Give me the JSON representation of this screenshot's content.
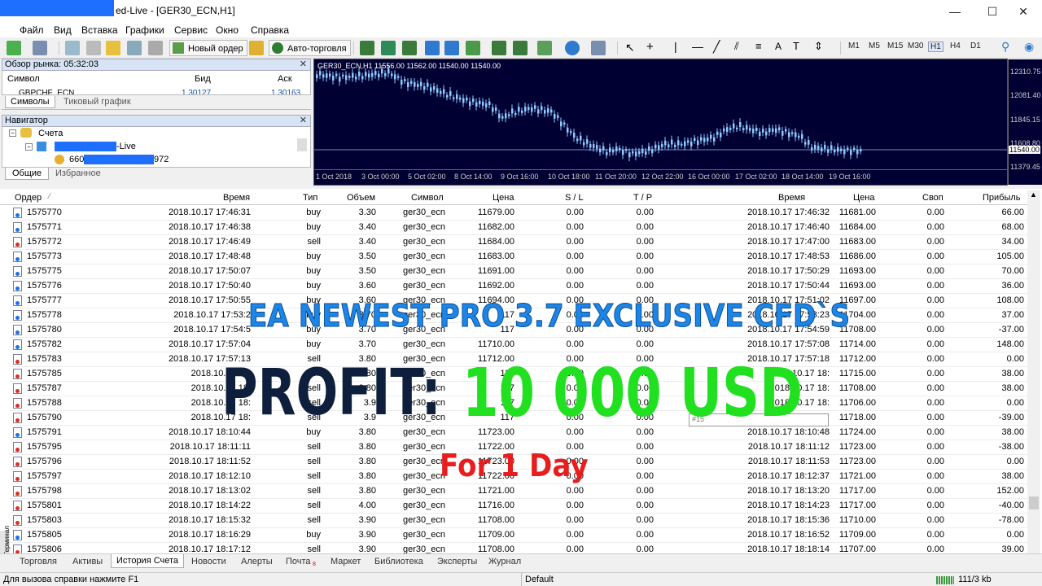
{
  "window": {
    "title_suffix": "ed-Live - [GER30_ECN,H1]",
    "minimize": "—",
    "maximize": "☐",
    "close": "✕"
  },
  "menu": [
    "Файл",
    "Вид",
    "Вставка",
    "Графики",
    "Сервис",
    "Окно",
    "Справка"
  ],
  "toolbar": {
    "new_order": "Новый ордер",
    "auto_trading": "Авто-торговля",
    "timeframes": [
      "M1",
      "M5",
      "M15",
      "M30",
      "H1",
      "H4",
      "D1"
    ],
    "text_tool": "A"
  },
  "market_watch": {
    "title": "Обзор рынка: 05:32:03",
    "col_symbol": "Символ",
    "col_bid": "Бид",
    "col_ask": "Аск",
    "row_symbol": "GBPCHF_ECN",
    "row_bid": "1.30127",
    "row_ask": "1.30163",
    "tab_symbols": "Символы",
    "tab_tick": "Тиковый график"
  },
  "navigator": {
    "title": "Навигатор",
    "accounts": "Счета",
    "account_suffix": "-Live",
    "account_prefix": "660",
    "account_end": "972",
    "tab_general": "Общие",
    "tab_fav": "Избранное"
  },
  "chart": {
    "header": "GER30_ECN,H1  11556.00 11562.00 11540.00 11540.00",
    "price_labels": [
      "12310.75",
      "12081.40",
      "11845.15",
      "11608.80",
      "11540.00",
      "11379.45"
    ],
    "time_labels": [
      "1 Oct 2018",
      "3 Oct 00:00",
      "5 Oct 02:00",
      "8 Oct 14:00",
      "9 Oct 16:00",
      "10 Oct 18:00",
      "11 Oct 20:00",
      "12 Oct 22:00",
      "16 Oct 00:00",
      "17 Oct 02:00",
      "18 Oct 14:00",
      "19 Oct 16:00"
    ]
  },
  "terminal": {
    "headers": {
      "order": "Ордер",
      "time": "Время",
      "type": "Тип",
      "volume": "Объем",
      "symbol": "Символ",
      "price": "Цена",
      "sl": "S / L",
      "tp": "T / P",
      "time2": "Время",
      "price2": "Цена",
      "swap": "Своп",
      "profit": "Прибыль"
    },
    "side_label": "Терминал",
    "rows": [
      {
        "order": "1575770",
        "time": "2018.10.17 17:46:31",
        "type": "buy",
        "volume": "3.30",
        "symbol": "ger30_ecn",
        "price": "11679.00",
        "sl": "0.00",
        "tp": "0.00",
        "time2": "2018.10.17 17:46:32",
        "price2": "11681.00",
        "swap": "0.00",
        "profit": "66.00"
      },
      {
        "order": "1575771",
        "time": "2018.10.17 17:46:38",
        "type": "buy",
        "volume": "3.40",
        "symbol": "ger30_ecn",
        "price": "11682.00",
        "sl": "0.00",
        "tp": "0.00",
        "time2": "2018.10.17 17:46:40",
        "price2": "11684.00",
        "swap": "0.00",
        "profit": "68.00"
      },
      {
        "order": "1575772",
        "time": "2018.10.17 17:46:49",
        "type": "sell",
        "volume": "3.40",
        "symbol": "ger30_ecn",
        "price": "11684.00",
        "sl": "0.00",
        "tp": "0.00",
        "time2": "2018.10.17 17:47:00",
        "price2": "11683.00",
        "swap": "0.00",
        "profit": "34.00"
      },
      {
        "order": "1575773",
        "time": "2018.10.17 17:48:48",
        "type": "buy",
        "volume": "3.50",
        "symbol": "ger30_ecn",
        "price": "11683.00",
        "sl": "0.00",
        "tp": "0.00",
        "time2": "2018.10.17 17:48:53",
        "price2": "11686.00",
        "swap": "0.00",
        "profit": "105.00"
      },
      {
        "order": "1575775",
        "time": "2018.10.17 17:50:07",
        "type": "buy",
        "volume": "3.50",
        "symbol": "ger30_ecn",
        "price": "11691.00",
        "sl": "0.00",
        "tp": "0.00",
        "time2": "2018.10.17 17:50:29",
        "price2": "11693.00",
        "swap": "0.00",
        "profit": "70.00"
      },
      {
        "order": "1575776",
        "time": "2018.10.17 17:50:40",
        "type": "buy",
        "volume": "3.60",
        "symbol": "ger30_ecn",
        "price": "11692.00",
        "sl": "0.00",
        "tp": "0.00",
        "time2": "2018.10.17 17:50:44",
        "price2": "11693.00",
        "swap": "0.00",
        "profit": "36.00"
      },
      {
        "order": "1575777",
        "time": "2018.10.17 17:50:55",
        "type": "buy",
        "volume": "3.60",
        "symbol": "ger30_ecn",
        "price": "11694.00",
        "sl": "0.00",
        "tp": "0.00",
        "time2": "2018.10.17 17:51:02",
        "price2": "11697.00",
        "swap": "0.00",
        "profit": "108.00"
      },
      {
        "order": "1575778",
        "time": "2018.10.17 17:53:2",
        "type": "buy",
        "volume": "3.70",
        "symbol": "ger30_ecn",
        "price": "117",
        "sl": "0.00",
        "tp": "0.00",
        "time2": "2018.10.17 17:53:23",
        "price2": "11704.00",
        "swap": "0.00",
        "profit": "37.00"
      },
      {
        "order": "1575780",
        "time": "2018.10.17 17:54:5",
        "type": "buy",
        "volume": "3.70",
        "symbol": "ger30_ecn",
        "price": "117",
        "sl": "0.00",
        "tp": "0.00",
        "time2": "2018.10.17 17:54:59",
        "price2": "11708.00",
        "swap": "0.00",
        "profit": "-37.00"
      },
      {
        "order": "1575782",
        "time": "2018.10.17 17:57:04",
        "type": "buy",
        "volume": "3.70",
        "symbol": "ger30_ecn",
        "price": "11710.00",
        "sl": "0.00",
        "tp": "0.00",
        "time2": "2018.10.17 17:57:08",
        "price2": "11714.00",
        "swap": "0.00",
        "profit": "148.00"
      },
      {
        "order": "1575783",
        "time": "2018.10.17 17:57:13",
        "type": "sell",
        "volume": "3.80",
        "symbol": "ger30_ecn",
        "price": "11712.00",
        "sl": "0.00",
        "tp": "0.00",
        "time2": "2018.10.17 17:57:18",
        "price2": "11712.00",
        "swap": "0.00",
        "profit": "0.00"
      },
      {
        "order": "1575785",
        "time": "2018.10.17 18:",
        "type": "sell",
        "volume": "3.80",
        "symbol": "ger30_ecn",
        "price": "117",
        "sl": "0.00",
        "tp": "0.00",
        "time2": "2018.10.17 18:",
        "price2": "11715.00",
        "swap": "0.00",
        "profit": "38.00"
      },
      {
        "order": "1575787",
        "time": "2018.10.17 18:",
        "type": "sell",
        "volume": "3.80",
        "symbol": "ger30_ecn",
        "price": "117",
        "sl": "0.00",
        "tp": "0.00",
        "time2": "2018.10.17 18:",
        "price2": "11708.00",
        "swap": "0.00",
        "profit": "38.00"
      },
      {
        "order": "1575788",
        "time": "2018.10.17 18:",
        "type": "sell",
        "volume": "3.9",
        "symbol": "ger30_ecn",
        "price": "117",
        "sl": "0.00",
        "tp": "0.00",
        "time2": "2018.10.17 18:",
        "price2": "11706.00",
        "swap": "0.00",
        "profit": "0.00"
      },
      {
        "order": "1575790",
        "time": "2018.10.17 18:",
        "type": "sell",
        "volume": "3.9",
        "symbol": "ger30_ecn",
        "price": "117",
        "sl": "0.00",
        "tp": "0.00",
        "time2": "2018.10.17 18:",
        "price2": "11718.00",
        "swap": "0.00",
        "profit": "-39.00"
      },
      {
        "order": "1575791",
        "time": "2018.10.17 18:10:44",
        "type": "buy",
        "volume": "3.80",
        "symbol": "ger30_ecn",
        "price": "11723.00",
        "sl": "0.00",
        "tp": "0.00",
        "time2": "2018.10.17 18:10:48",
        "price2": "11724.00",
        "swap": "0.00",
        "profit": "38.00"
      },
      {
        "order": "1575795",
        "time": "2018.10.17 18:11:11",
        "type": "sell",
        "volume": "3.80",
        "symbol": "ger30_ecn",
        "price": "11722.00",
        "sl": "0.00",
        "tp": "0.00",
        "time2": "2018.10.17 18:11:12",
        "price2": "11723.00",
        "swap": "0.00",
        "profit": "-38.00"
      },
      {
        "order": "1575796",
        "time": "2018.10.17 18:11:52",
        "type": "sell",
        "volume": "3.80",
        "symbol": "ger30_ecn",
        "price": "11723.00",
        "sl": "0.00",
        "tp": "0.00",
        "time2": "2018.10.17 18:11:53",
        "price2": "11723.00",
        "swap": "0.00",
        "profit": "0.00"
      },
      {
        "order": "1575797",
        "time": "2018.10.17 18:12:10",
        "type": "sell",
        "volume": "3.80",
        "symbol": "ger30_ecn",
        "price": "11722.00",
        "sl": "0.00",
        "tp": "0.00",
        "time2": "2018.10.17 18:12:37",
        "price2": "11721.00",
        "swap": "0.00",
        "profit": "38.00"
      },
      {
        "order": "1575798",
        "time": "2018.10.17 18:13:02",
        "type": "sell",
        "volume": "3.80",
        "symbol": "ger30_ecn",
        "price": "11721.00",
        "sl": "0.00",
        "tp": "0.00",
        "time2": "2018.10.17 18:13:20",
        "price2": "11717.00",
        "swap": "0.00",
        "profit": "152.00"
      },
      {
        "order": "1575801",
        "time": "2018.10.17 18:14:22",
        "type": "sell",
        "volume": "4.00",
        "symbol": "ger30_ecn",
        "price": "11716.00",
        "sl": "0.00",
        "tp": "0.00",
        "time2": "2018.10.17 18:14:23",
        "price2": "11717.00",
        "swap": "0.00",
        "profit": "-40.00"
      },
      {
        "order": "1575803",
        "time": "2018.10.17 18:15:32",
        "type": "sell",
        "volume": "3.90",
        "symbol": "ger30_ecn",
        "price": "11708.00",
        "sl": "0.00",
        "tp": "0.00",
        "time2": "2018.10.17 18:15:36",
        "price2": "11710.00",
        "swap": "0.00",
        "profit": "-78.00"
      },
      {
        "order": "1575805",
        "time": "2018.10.17 18:16:29",
        "type": "buy",
        "volume": "3.90",
        "symbol": "ger30_ecn",
        "price": "11709.00",
        "sl": "0.00",
        "tp": "0.00",
        "time2": "2018.10.17 18:16:52",
        "price2": "11709.00",
        "swap": "0.00",
        "profit": "0.00"
      },
      {
        "order": "1575806",
        "time": "2018.10.17 18:17:12",
        "type": "sell",
        "volume": "3.90",
        "symbol": "ger30_ecn",
        "price": "11708.00",
        "sl": "0.00",
        "tp": "0.00",
        "time2": "2018.10.17 18:18:14",
        "price2": "11707.00",
        "swap": "0.00",
        "profit": "39.00"
      }
    ],
    "tooltip": "#15"
  },
  "bottom_tabs": [
    "Торговля",
    "Активы",
    "История Счета",
    "Новости",
    "Алерты",
    "Почта",
    "Маркет",
    "Библиотека",
    "Эксперты",
    "Журнал"
  ],
  "mail_badge": "8",
  "status": {
    "help": "Для вызова справки нажмите F1",
    "profile": "Default",
    "traffic": "111/3 kb"
  },
  "overlay": {
    "line1": "EA NEWEST PRO 3.7 EXCLUSIVE CFD`S",
    "profit_label": "PROFIT:",
    "profit_value": "10 000 USD",
    "period": "For 1 Day"
  },
  "colors": {
    "redact_blue": "#1e6fff",
    "chart_bg": "#000033",
    "candle": "#8ecbff",
    "overlay_blue": "#1c86e8",
    "overlay_navy": "#0e1f3d",
    "overlay_green": "#20e020",
    "overlay_red": "#e81e1e"
  }
}
